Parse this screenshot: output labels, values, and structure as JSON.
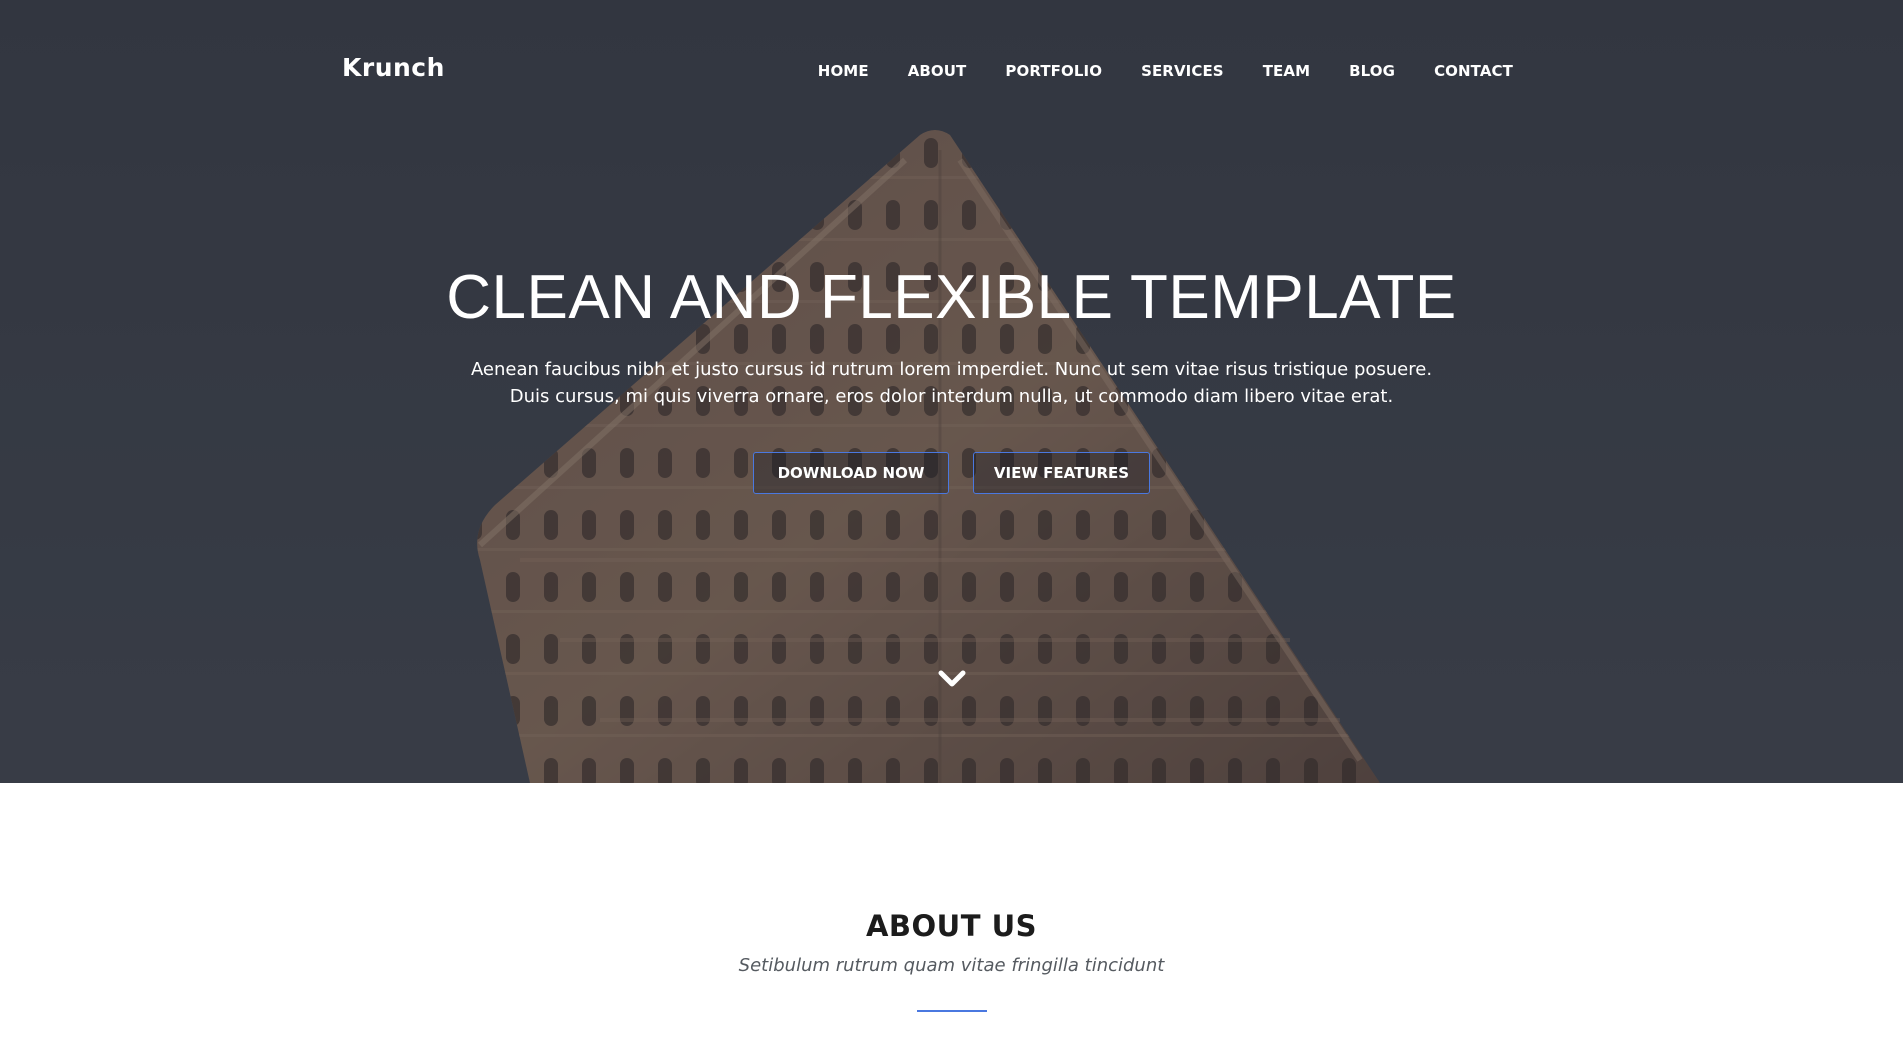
{
  "brand": {
    "name": "Krunch"
  },
  "nav": {
    "items": [
      {
        "label": "HOME"
      },
      {
        "label": "ABOUT"
      },
      {
        "label": "PORTFOLIO"
      },
      {
        "label": "SERVICES"
      },
      {
        "label": "TEAM"
      },
      {
        "label": "BLOG"
      },
      {
        "label": "CONTACT"
      }
    ]
  },
  "hero": {
    "title": "CLEAN AND FLEXIBLE TEMPLATE",
    "text_line1": "Aenean faucibus nibh et justo cursus id rutrum lorem imperdiet. Nunc ut sem vitae risus tristique posuere.",
    "text_line2": "Duis cursus, mi quis viverra ornare, eros dolor interdum nulla, ut commodo diam libero vitae erat.",
    "download_label": "DOWNLOAD NOW",
    "features_label": "VIEW FEATURES",
    "scroll_icon": "chevron-down-icon"
  },
  "about": {
    "title": "ABOUT US",
    "subtitle": "Setibulum rutrum quam vitae fringilla tincidunt"
  },
  "colors": {
    "accent": "#4a78e0",
    "hero_overlay": "#3a3d46",
    "heading": "#1c1c1c",
    "subtitle": "#555a60"
  }
}
